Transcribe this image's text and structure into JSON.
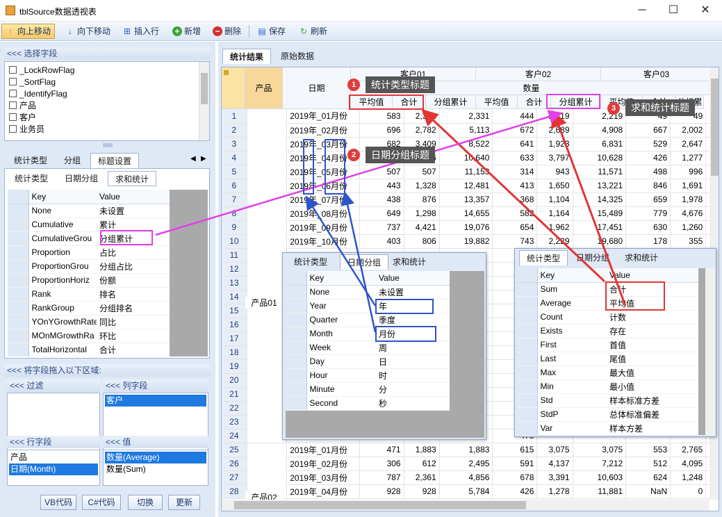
{
  "window": {
    "title": "tblSource数据透视表",
    "min": "─",
    "max": "☐",
    "close": "✕"
  },
  "toolbar": [
    {
      "label": "向上移动",
      "icon": "↑",
      "color": "#d9a21c"
    },
    {
      "label": "向下移动",
      "icon": "↓",
      "color": "#2a5fc4"
    },
    {
      "label": "插入行",
      "icon": "⊞",
      "color": "#2a5fc4"
    },
    {
      "label": "新增",
      "icon": "+",
      "color": "#3aa537"
    },
    {
      "label": "删除",
      "icon": "−",
      "color": "#d42f2f"
    },
    {
      "label": "保存",
      "icon": "▤",
      "color": "#2a5fc4"
    },
    {
      "label": "刷新",
      "icon": "↻",
      "color": "#3aa537"
    }
  ],
  "left": {
    "choose_fields": "<<< 选择字段",
    "fields": [
      "_LockRowFlag",
      "_SortFlag",
      "_IdentifyFlag",
      "产品",
      "客户",
      "业务员"
    ],
    "tabs1": [
      "统计类型",
      "分组",
      "标题设置"
    ],
    "tabs2": [
      "统计类型",
      "日期分组",
      "求和统计"
    ],
    "kv_header": {
      "key": "Key",
      "value": "Value"
    },
    "kv": [
      [
        "None",
        "未设置"
      ],
      [
        "Cumulative",
        "累计"
      ],
      [
        "CumulativeGrou",
        "分组累计"
      ],
      [
        "Proportion",
        "占比"
      ],
      [
        "ProportionGrou",
        "分组占比"
      ],
      [
        "ProportionHoriz",
        "份额"
      ],
      [
        "Rank",
        "排名"
      ],
      [
        "RankGroup",
        "分组排名"
      ],
      [
        "YOnYGrowthRate",
        "同比"
      ],
      [
        "MOnMGrowthRa",
        "环比"
      ],
      [
        "TotalHorizontal",
        "合计"
      ]
    ],
    "drag_title": "<<< 将字段拖入以下区域:",
    "filter": "<<< 过滤",
    "col_field": "<<< 列字段",
    "col_items": [
      "客户"
    ],
    "row_field": "<<< 行字段",
    "row_items": [
      "产品",
      "日期(Month)"
    ],
    "value_field": "<<< 值",
    "value_items": [
      "数量(Average)",
      "数量(Sum)"
    ],
    "buttons": [
      "VB代码",
      "C#代码",
      "切换",
      "更新"
    ]
  },
  "right": {
    "tabs": [
      "统计结果",
      "原始数据"
    ],
    "hdr": {
      "product": "产品",
      "date": "日期",
      "qty": "数量",
      "customers": [
        "客户01",
        "客户02",
        "客户03"
      ],
      "sub": [
        "平均值",
        "合计",
        "分组累计",
        "平均值",
        "合计",
        "分组累计",
        "平均值",
        "合计",
        "分组累计"
      ]
    },
    "rows1_label": "产品01",
    "rows2_label": "产品02",
    "rows": [
      [
        "1",
        "2019年_01月份",
        "583",
        "2,331",
        "2,331",
        "444",
        "2,219",
        "2,219",
        "49",
        "49",
        "4"
      ],
      [
        "2",
        "2019年_02月份",
        "696",
        "2,782",
        "5,113",
        "672",
        "2,689",
        "4,908",
        "667",
        "2,002",
        "2,"
      ],
      [
        "3",
        "2019年_03月份",
        "682",
        "3,409",
        "8,522",
        "641",
        "1,923",
        "6,831",
        "529",
        "2,647",
        "4,"
      ],
      [
        "4",
        "2019年_04月份",
        "633",
        "1,266",
        "10,640",
        "633",
        "3,797",
        "10,628",
        "426",
        "1,277",
        "5,"
      ],
      [
        "5",
        "2019年_05月份",
        "507",
        "507",
        "11,153",
        "314",
        "943",
        "11,571",
        "498",
        "996",
        "6,"
      ],
      [
        "6",
        "2019年_06月份",
        "443",
        "1,328",
        "12,481",
        "413",
        "1,650",
        "13,221",
        "846",
        "1,691",
        "8,"
      ],
      [
        "7",
        "2019年_07月份",
        "438",
        "876",
        "13,357",
        "368",
        "1,104",
        "14,325",
        "659",
        "1,978",
        "10,"
      ],
      [
        "8",
        "2019年_08月份",
        "649",
        "1,298",
        "14,655",
        "582",
        "1,164",
        "15,489",
        "779",
        "4,676",
        "15,"
      ],
      [
        "9",
        "2019年_09月份",
        "737",
        "4,421",
        "19,076",
        "654",
        "1,962",
        "17,451",
        "630",
        "1,260",
        "16,"
      ],
      [
        "10",
        "2019年_10月份",
        "403",
        "806",
        "19,882",
        "743",
        "2,229",
        "19,680",
        "178",
        "355",
        "16,"
      ],
      [
        "11",
        "",
        "",
        "",
        "",
        "351",
        "",
        "",
        "",
        "",
        ""
      ],
      [
        "12",
        "",
        "",
        "",
        "",
        "166",
        "",
        "",
        "",
        "",
        ""
      ],
      [
        "13",
        "",
        "",
        "",
        "",
        "650",
        "",
        "",
        "",
        "",
        ""
      ],
      [
        "14",
        "",
        "",
        "",
        "",
        "446",
        "",
        "",
        "",
        "",
        ""
      ],
      [
        "15",
        "",
        "",
        "",
        "",
        "802",
        "",
        "",
        "",
        "",
        ""
      ],
      [
        "16",
        "",
        "",
        "",
        "",
        "479",
        "",
        "",
        "",
        "",
        ""
      ],
      [
        "17",
        "",
        "",
        "",
        "",
        "765",
        "",
        "",
        "",
        "",
        ""
      ],
      [
        "18",
        "",
        "",
        "",
        "",
        "525",
        "",
        "",
        "",
        "",
        ""
      ],
      [
        "19",
        "",
        "",
        "",
        "",
        "521",
        "",
        "",
        "",
        "",
        ""
      ],
      [
        "20",
        "",
        "",
        "",
        "",
        "348",
        "",
        "",
        "",
        "",
        ""
      ],
      [
        "21",
        "",
        "",
        "",
        "",
        "690",
        "",
        "",
        "",
        "",
        ""
      ],
      [
        "22",
        "",
        "",
        "",
        "",
        "554",
        "",
        "",
        "",
        "",
        ""
      ],
      [
        "23",
        "",
        "",
        "",
        "",
        "242",
        "",
        "",
        "",
        "",
        ""
      ],
      [
        "24",
        "",
        "",
        "",
        "",
        "473",
        "",
        "",
        "",
        "",
        ""
      ],
      [
        "25",
        "2019年_01月份",
        "471",
        "1,883",
        "1,883",
        "615",
        "3,075",
        "3,075",
        "553",
        "2,765",
        "2,"
      ],
      [
        "26",
        "2019年_02月份",
        "306",
        "612",
        "2,495",
        "591",
        "4,137",
        "7,212",
        "512",
        "4,095",
        "6,"
      ],
      [
        "27",
        "2019年_03月份",
        "787",
        "2,361",
        "4,856",
        "678",
        "3,391",
        "10,603",
        "624",
        "1,248",
        "8,"
      ],
      [
        "28",
        "2019年_04月份",
        "928",
        "928",
        "5,784",
        "426",
        "1,278",
        "11,881",
        "NaN",
        "0",
        "8,"
      ]
    ]
  },
  "callouts": [
    {
      "num": "1",
      "text": "统计类型标题"
    },
    {
      "num": "2",
      "text": "日期分组标题"
    },
    {
      "num": "3",
      "text": "求和统计标题"
    }
  ],
  "popup_date": {
    "tabs": [
      "统计类型",
      "日期分组",
      "求和统计"
    ],
    "kv": [
      [
        "None",
        "未设置"
      ],
      [
        "Year",
        "年"
      ],
      [
        "Quarter",
        "季度"
      ],
      [
        "Month",
        "月份"
      ],
      [
        "Week",
        "周"
      ],
      [
        "Day",
        "日"
      ],
      [
        "Hour",
        "时"
      ],
      [
        "Minute",
        "分"
      ],
      [
        "Second",
        "秒"
      ]
    ]
  },
  "popup_sum": {
    "tabs": [
      "统计类型",
      "日期分组",
      "求和统计"
    ],
    "kv": [
      [
        "Sum",
        "合计"
      ],
      [
        "Average",
        "平均值"
      ],
      [
        "Count",
        "计数"
      ],
      [
        "Exists",
        "存在"
      ],
      [
        "First",
        "首值"
      ],
      [
        "Last",
        "尾值"
      ],
      [
        "Max",
        "最大值"
      ],
      [
        "Min",
        "最小值"
      ],
      [
        "Std",
        "样本标准方差"
      ],
      [
        "StdP",
        "总体标准偏差"
      ],
      [
        "Var",
        "样本方差"
      ]
    ]
  }
}
